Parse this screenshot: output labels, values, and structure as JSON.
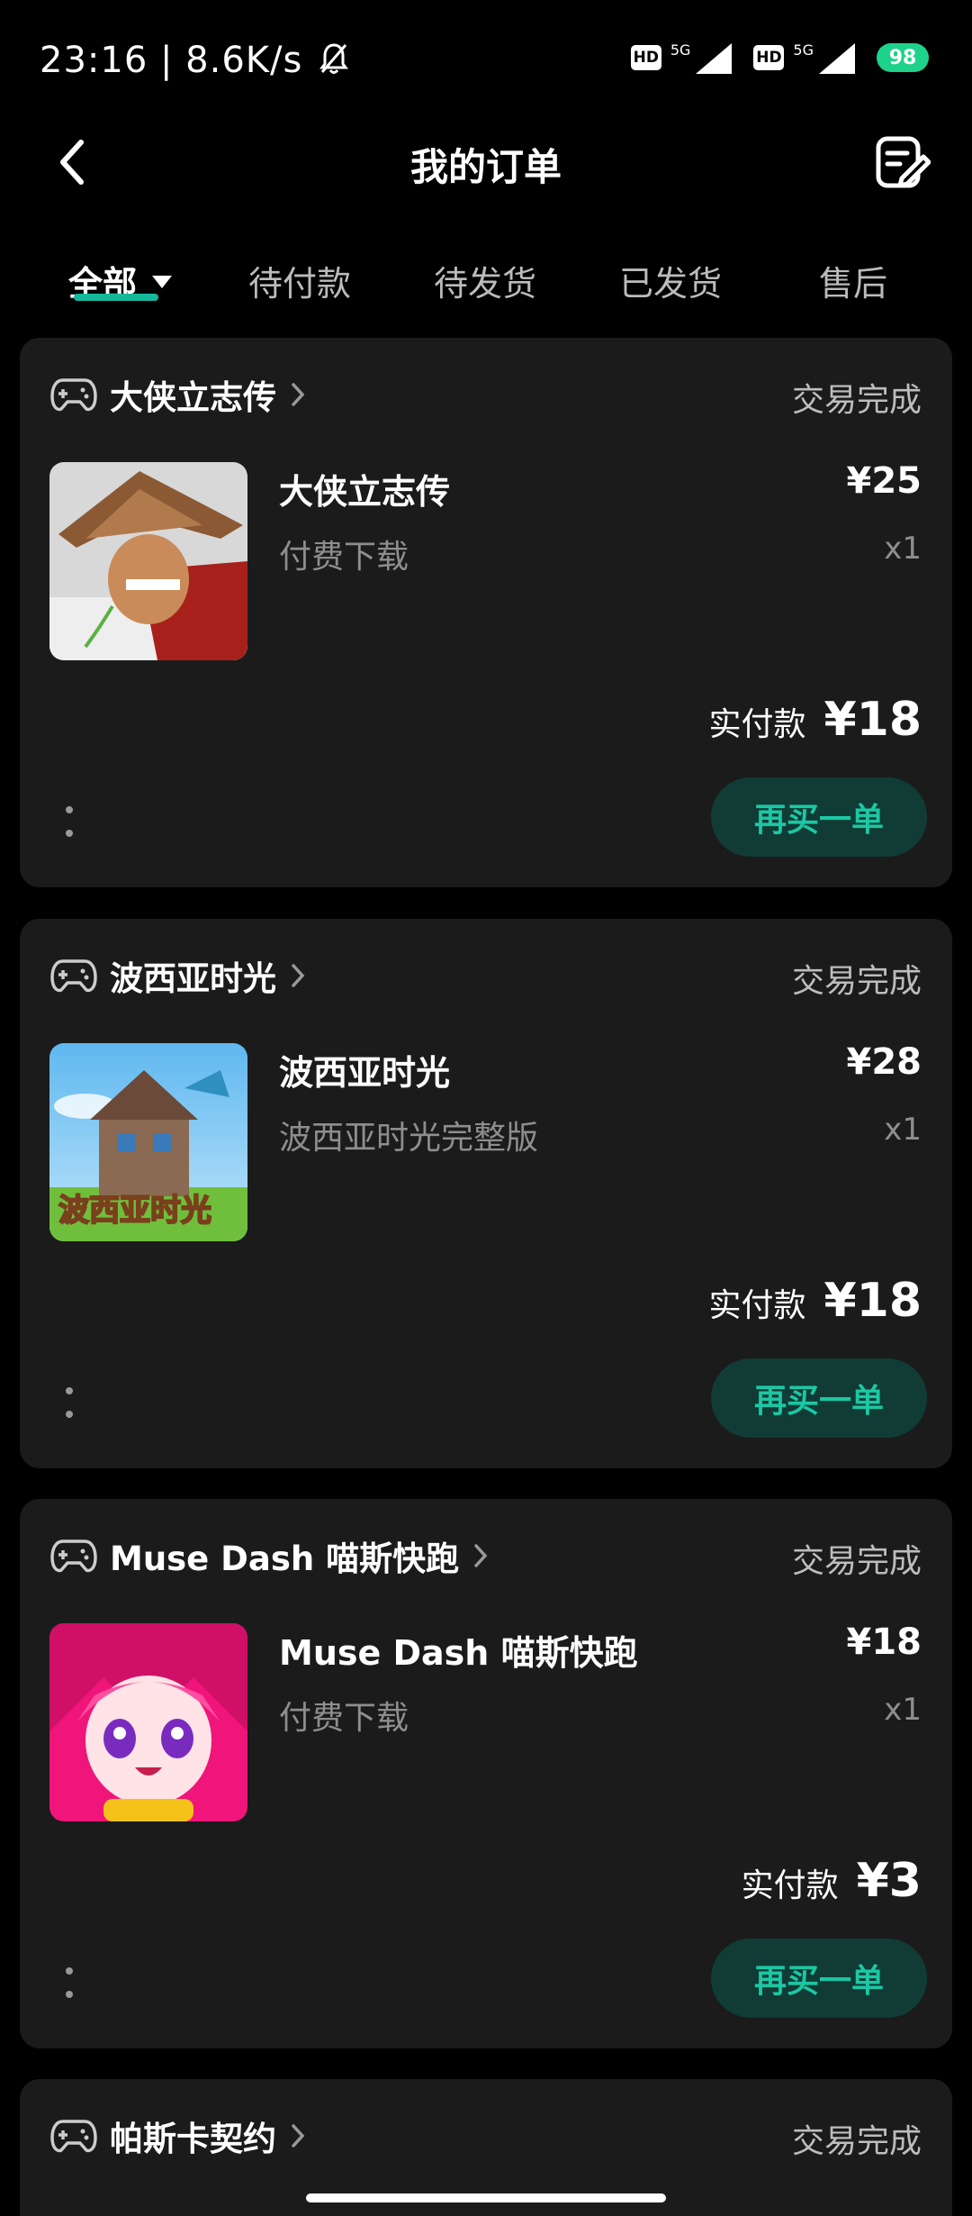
{
  "status_bar": {
    "time_speed": "23:16 | 8.6K/s",
    "hd1": "HD",
    "net1": "5G",
    "hd2": "HD",
    "net2": "5G",
    "battery": "98"
  },
  "header": {
    "title": "我的订单"
  },
  "tabs": [
    {
      "label": "全部"
    },
    {
      "label": "待付款"
    },
    {
      "label": "待发货"
    },
    {
      "label": "已发货"
    },
    {
      "label": "售后"
    }
  ],
  "orders": [
    {
      "shop": "大侠立志传",
      "status": "交易完成",
      "name": "大侠立志传",
      "sub": "付费下载",
      "price": "¥25",
      "qty": "x1",
      "paid_label": "实付款",
      "paid": "¥18",
      "rebuy": "再买一单"
    },
    {
      "shop": "波西亚时光",
      "status": "交易完成",
      "name": "波西亚时光",
      "sub": "波西亚时光完整版",
      "price": "¥28",
      "qty": "x1",
      "paid_label": "实付款",
      "paid": "¥18",
      "rebuy": "再买一单",
      "thumb_text": "波西亚时光"
    },
    {
      "shop": "Muse Dash 喵斯快跑",
      "status": "交易完成",
      "name": "Muse Dash 喵斯快跑",
      "sub": "付费下载",
      "price": "¥18",
      "qty": "x1",
      "paid_label": "实付款",
      "paid": "¥3",
      "rebuy": "再买一单"
    },
    {
      "shop": "帕斯卡契约",
      "status": "交易完成"
    }
  ],
  "colors": {
    "accent": "#16b89b",
    "card_bg": "#1b1b1b",
    "rebuy_bg": "#103c35",
    "rebuy_text": "#1cc7a4",
    "battery": "#1ed28a"
  }
}
